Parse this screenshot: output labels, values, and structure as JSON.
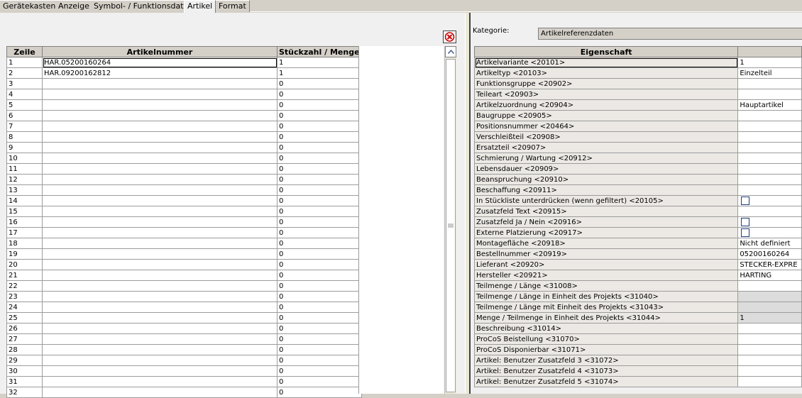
{
  "tabs": [
    "Gerätekasten",
    "Anzeige",
    "Symbol- / Funktionsdaten",
    "Artikel",
    "Format"
  ],
  "left_table": {
    "headers": {
      "zeile": "Zeile",
      "artikelnummer": "Artikelnummer",
      "menge": "Stückzahl / Menge"
    },
    "rows": [
      {
        "zeile": "1",
        "artikelnummer": "HAR.05200160264",
        "menge": "1"
      },
      {
        "zeile": "2",
        "artikelnummer": "HAR.09200162812",
        "menge": "1"
      },
      {
        "zeile": "3",
        "artikelnummer": "",
        "menge": "0"
      },
      {
        "zeile": "4",
        "artikelnummer": "",
        "menge": "0"
      },
      {
        "zeile": "5",
        "artikelnummer": "",
        "menge": "0"
      },
      {
        "zeile": "6",
        "artikelnummer": "",
        "menge": "0"
      },
      {
        "zeile": "7",
        "artikelnummer": "",
        "menge": "0"
      },
      {
        "zeile": "8",
        "artikelnummer": "",
        "menge": "0"
      },
      {
        "zeile": "9",
        "artikelnummer": "",
        "menge": "0"
      },
      {
        "zeile": "10",
        "artikelnummer": "",
        "menge": "0"
      },
      {
        "zeile": "11",
        "artikelnummer": "",
        "menge": "0"
      },
      {
        "zeile": "12",
        "artikelnummer": "",
        "menge": "0"
      },
      {
        "zeile": "13",
        "artikelnummer": "",
        "menge": "0"
      },
      {
        "zeile": "14",
        "artikelnummer": "",
        "menge": "0"
      },
      {
        "zeile": "15",
        "artikelnummer": "",
        "menge": "0"
      },
      {
        "zeile": "16",
        "artikelnummer": "",
        "menge": "0"
      },
      {
        "zeile": "17",
        "artikelnummer": "",
        "menge": "0"
      },
      {
        "zeile": "18",
        "artikelnummer": "",
        "menge": "0"
      },
      {
        "zeile": "19",
        "artikelnummer": "",
        "menge": "0"
      },
      {
        "zeile": "20",
        "artikelnummer": "",
        "menge": "0"
      },
      {
        "zeile": "21",
        "artikelnummer": "",
        "menge": "0"
      },
      {
        "zeile": "22",
        "artikelnummer": "",
        "menge": "0"
      },
      {
        "zeile": "23",
        "artikelnummer": "",
        "menge": "0"
      },
      {
        "zeile": "24",
        "artikelnummer": "",
        "menge": "0"
      },
      {
        "zeile": "25",
        "artikelnummer": "",
        "menge": "0"
      },
      {
        "zeile": "26",
        "artikelnummer": "",
        "menge": "0"
      },
      {
        "zeile": "27",
        "artikelnummer": "",
        "menge": "0"
      },
      {
        "zeile": "28",
        "artikelnummer": "",
        "menge": "0"
      },
      {
        "zeile": "29",
        "artikelnummer": "",
        "menge": "0"
      },
      {
        "zeile": "30",
        "artikelnummer": "",
        "menge": "0"
      },
      {
        "zeile": "31",
        "artikelnummer": "",
        "menge": "0"
      },
      {
        "zeile": "32",
        "artikelnummer": "",
        "menge": "0"
      }
    ]
  },
  "kategorie": {
    "label": "Kategorie:",
    "value": "Artikelreferenzdaten"
  },
  "right_table": {
    "header": "Eigenschaft",
    "rows": [
      {
        "prop": "Artikelvariante <20101>",
        "value": "1",
        "type": "text",
        "grey": false
      },
      {
        "prop": "Artikeltyp <20103>",
        "value": "Einzelteil",
        "type": "text",
        "grey": false
      },
      {
        "prop": "Funktionsgruppe <20902>",
        "value": "",
        "type": "text",
        "grey": false
      },
      {
        "prop": "Teileart <20903>",
        "value": "",
        "type": "text",
        "grey": false
      },
      {
        "prop": "Artikelzuordnung <20904>",
        "value": "Hauptartikel",
        "type": "text",
        "grey": false
      },
      {
        "prop": "Baugruppe <20905>",
        "value": "",
        "type": "text",
        "grey": false
      },
      {
        "prop": "Positionsnummer <20464>",
        "value": "",
        "type": "text",
        "grey": false
      },
      {
        "prop": "Verschleißteil <20908>",
        "value": "",
        "type": "text",
        "grey": false
      },
      {
        "prop": "Ersatzteil <20907>",
        "value": "",
        "type": "text",
        "grey": false
      },
      {
        "prop": "Schmierung / Wartung <20912>",
        "value": "",
        "type": "text",
        "grey": false
      },
      {
        "prop": "Lebensdauer <20909>",
        "value": "",
        "type": "text",
        "grey": false
      },
      {
        "prop": "Beanspruchung <20910>",
        "value": "",
        "type": "text",
        "grey": false
      },
      {
        "prop": "Beschaffung <20911>",
        "value": "",
        "type": "text",
        "grey": false
      },
      {
        "prop": "In Stückliste unterdrücken (wenn gefiltert) <20105>",
        "value": "",
        "type": "checkbox",
        "grey": false
      },
      {
        "prop": "Zusatzfeld Text <20915>",
        "value": "",
        "type": "text",
        "grey": false
      },
      {
        "prop": "Zusatzfeld Ja / Nein  <20916>",
        "value": "",
        "type": "checkbox",
        "grey": false
      },
      {
        "prop": "Externe Platzierung <20917>",
        "value": "",
        "type": "checkbox",
        "grey": false
      },
      {
        "prop": "Montagefläche <20918>",
        "value": "Nicht definiert",
        "type": "text",
        "grey": false
      },
      {
        "prop": "Bestellnummer <20919>",
        "value": "05200160264",
        "type": "text",
        "grey": false
      },
      {
        "prop": "Lieferant <20920>",
        "value": "STECKER-EXPRE",
        "type": "text",
        "grey": false
      },
      {
        "prop": "Hersteller <20921>",
        "value": "HARTING",
        "type": "text",
        "grey": false
      },
      {
        "prop": "Teilmenge / Länge <31008>",
        "value": "",
        "type": "text",
        "grey": false
      },
      {
        "prop": "Teilmenge / Länge in Einheit des Projekts <31040>",
        "value": "",
        "type": "text",
        "grey": true
      },
      {
        "prop": "Teilmenge / Länge mit Einheit des Projekts <31043>",
        "value": "",
        "type": "text",
        "grey": true
      },
      {
        "prop": "Menge / Teilmenge in Einheit des Projekts <31044>",
        "value": "1",
        "type": "text",
        "grey": true
      },
      {
        "prop": "Beschreibung <31014>",
        "value": "",
        "type": "text",
        "grey": false
      },
      {
        "prop": "ProCoS Beistellung <31070>",
        "value": "",
        "type": "text",
        "grey": false
      },
      {
        "prop": "ProCoS Disponierbar <31071>",
        "value": "",
        "type": "text",
        "grey": false
      },
      {
        "prop": "Artikel: Benutzer Zusatzfeld 3 <31072>",
        "value": "",
        "type": "text",
        "grey": false
      },
      {
        "prop": "Artikel: Benutzer Zusatzfeld 4 <31073>",
        "value": "",
        "type": "text",
        "grey": false
      },
      {
        "prop": "Artikel: Benutzer Zusatzfeld 5 <31074>",
        "value": "",
        "type": "text",
        "grey": false
      }
    ]
  },
  "icons": {
    "close": "close-icon",
    "scroll_up": "scroll-up-icon",
    "grip": "scroll-grip-icon"
  },
  "colors": {
    "close_red": "#cc0000",
    "panel_bg": "#f0f0f0",
    "header_bg": "#d4d0c8"
  }
}
